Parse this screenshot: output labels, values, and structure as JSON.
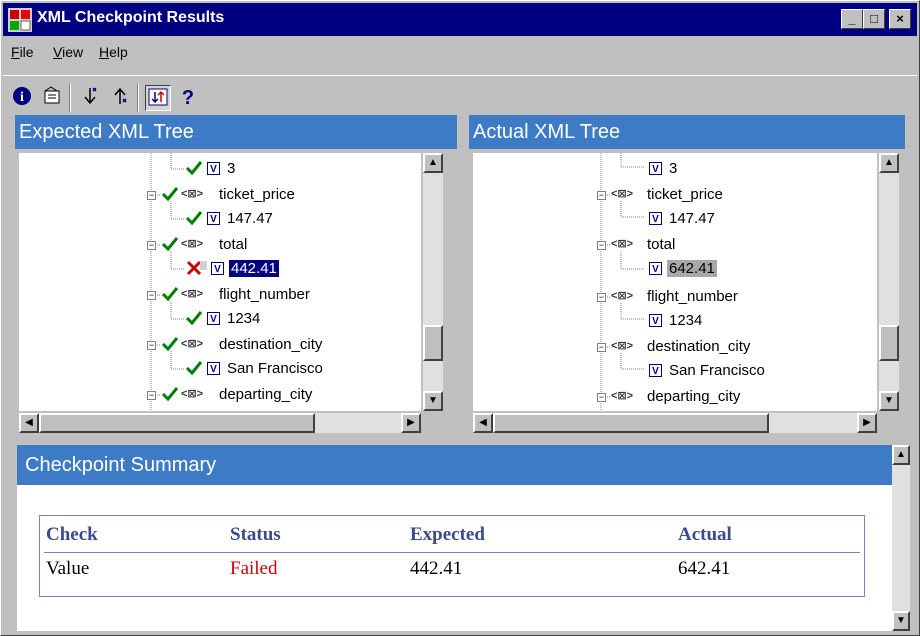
{
  "window": {
    "title": "XML Checkpoint Results",
    "controls": [
      "_",
      "□",
      "×"
    ]
  },
  "menu": [
    {
      "label": "File",
      "u": "F",
      "rest": "ile"
    },
    {
      "label": "View",
      "u": "V",
      "rest": "iew"
    },
    {
      "label": "Help",
      "u": "H",
      "rest": "elp"
    }
  ],
  "toolbar": {
    "info_icon": "i",
    "props_icon": "properties-icon",
    "next_icon": "next-mismatch-icon",
    "prev_icon": "prev-mismatch-icon",
    "sync_icon": "synchronize-icon",
    "help_icon": "?"
  },
  "expected": {
    "title": "Expected XML Tree",
    "nodes": [
      "3",
      "ticket_price",
      "147.47",
      "total",
      "442.41",
      "flight_number",
      "1234",
      "destination_city",
      "San Francisco",
      "departing_city"
    ]
  },
  "actual": {
    "title": "Actual XML Tree",
    "nodes": [
      "3",
      "ticket_price",
      "147.47",
      "total",
      "642.41",
      "flight_number",
      "1234",
      "destination_city",
      "San Francisco",
      "departing_city"
    ]
  },
  "summary": {
    "title": "Checkpoint Summary",
    "headers": {
      "check": "Check",
      "status": "Status",
      "expected": "Expected",
      "actual": "Actual"
    },
    "row": {
      "check": "Value",
      "status": "Failed",
      "expected": "442.41",
      "actual": "642.41"
    },
    "status_color": "#cc0000",
    "header_color": "#3b4a8a"
  },
  "colors": {
    "title_bar": "#000080",
    "pane_header": "#3d7bc7",
    "check_mark": "#008000",
    "fail_mark": "#cc0000"
  }
}
